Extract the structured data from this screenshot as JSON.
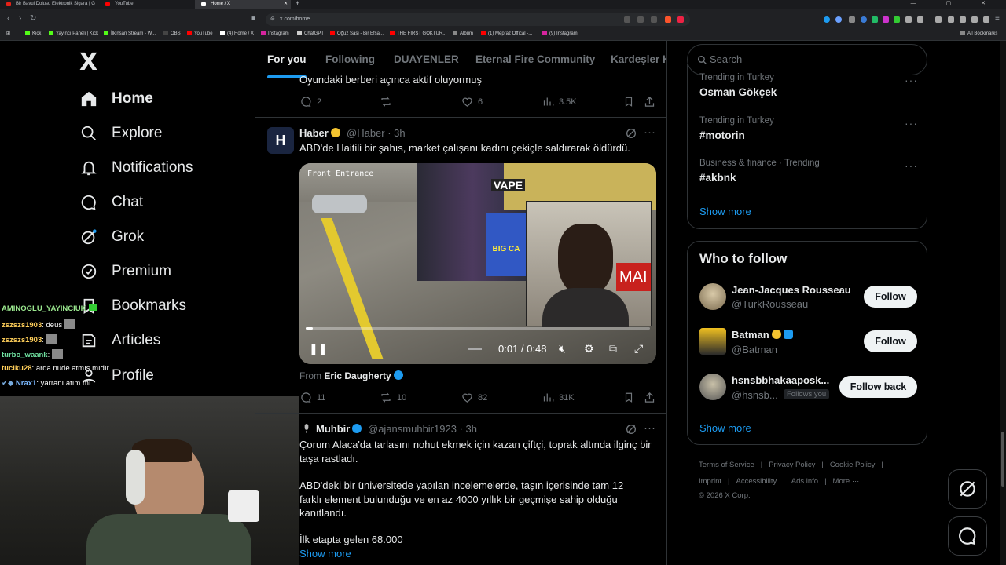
{
  "browser": {
    "tabs": [
      {
        "title": "Bir Bavul Dolusu Elektronik Sigara | G",
        "color": "#e62117"
      },
      {
        "title": "YouTube",
        "color": "#ff0000"
      },
      {
        "title": "Home / X",
        "color": "#ffffff"
      }
    ],
    "url": "x.com/home",
    "bookmarks": [
      {
        "label": "Kick",
        "color": "#53fc18"
      },
      {
        "label": "Yayıncı Paneli | Kick",
        "color": "#53fc18"
      },
      {
        "label": "İlkinsan Stream - W...",
        "color": "#53fc18"
      },
      {
        "label": "OBS",
        "color": "#444"
      },
      {
        "label": "YouTube",
        "color": "#ff0000"
      },
      {
        "label": "(4) Home / X",
        "color": "#ffffff"
      },
      {
        "label": "Instagram",
        "color": "#d6249f"
      },
      {
        "label": "ChatGPT",
        "color": "#cccccc"
      },
      {
        "label": "Oğuz Sasi - Bir Efsa...",
        "color": "#ff0000"
      },
      {
        "label": "THE FIRST GOKTUR...",
        "color": "#ff0000"
      },
      {
        "label": "Albüm",
        "color": "#888"
      },
      {
        "label": "(1) Mepraz Offical -...",
        "color": "#ff0000"
      },
      {
        "label": "(9) Instagram",
        "color": "#d6249f"
      }
    ],
    "all_bookmarks": "All Bookmarks"
  },
  "sidebar": {
    "logo": "X",
    "items": [
      {
        "label": "Home",
        "icon": "home-icon"
      },
      {
        "label": "Explore",
        "icon": "search-icon"
      },
      {
        "label": "Notifications",
        "icon": "bell-icon"
      },
      {
        "label": "Chat",
        "icon": "chat-icon"
      },
      {
        "label": "Grok",
        "icon": "grok-icon"
      },
      {
        "label": "Premium",
        "icon": "premium-icon"
      },
      {
        "label": "Bookmarks",
        "icon": "bookmark-icon"
      },
      {
        "label": "Articles",
        "icon": "article-icon"
      },
      {
        "label": "Profile",
        "icon": "profile-icon"
      }
    ]
  },
  "stream_chat": [
    {
      "user": "AMINOGLU_YAYINCIUK",
      "msg": ""
    },
    {
      "user": "zszszs1903",
      "msg": "deus"
    },
    {
      "user": "zszszs1903",
      "msg": ""
    },
    {
      "user": "turbo_waank",
      "msg": ""
    },
    {
      "user": "tuciku28",
      "msg": "arda nude atmış mıdır"
    },
    {
      "user": "Nrax1",
      "msg": "yarranı atım mı"
    }
  ],
  "feed": {
    "tabs": [
      "For you",
      "Following",
      "DUAYENLER",
      "Eternal Fire Community",
      "Kardeşler Kı"
    ],
    "prev_post": {
      "text": "Oyundaki berberi açınca aktif oluyormuş",
      "replies": "2",
      "reposts": "",
      "likes": "6",
      "views": "3.5K"
    },
    "post1": {
      "avatar_letter": "H",
      "name": "Haber",
      "handle": "@Haber · 3h",
      "text": "ABD'de Haitili bir şahıs, market çalışanı kadını çekiçle saldırarak öldürdü.",
      "video_sign": "Front Entrance",
      "video_store": "VAPE",
      "video_promo": "BIG CA",
      "video_badge": "MAI",
      "video_time": "0:01 / 0:48",
      "video_progress": 0.02,
      "from_label": "From",
      "from_name": "Eric Daugherty",
      "replies": "11",
      "reposts": "10",
      "likes": "82",
      "views": "31K"
    },
    "post2": {
      "name": "Muhbir",
      "handle": "@ajansmuhbir1923 · 3h",
      "p1": "Çorum Alaca'da tarlasını nohut ekmek için kazan çiftçi, toprak altında ilginç bir taşa rastladı.",
      "p2": "ABD'deki bir üniversitede yapılan incelemelerde, taşın içerisinde tam 12 farklı element bulunduğu ve en az 4000 yıllık bir geçmişe sahip olduğu kanıtlandı.",
      "p3": "İlk etapta gelen 68.000",
      "show_more": "Show more"
    }
  },
  "right": {
    "search_placeholder": "Search",
    "trends": [
      {
        "meta": "Trending in Turkey",
        "name": "Osman Gökçek"
      },
      {
        "meta": "Trending in Turkey",
        "name": "#motorin"
      },
      {
        "meta": "Business & finance · Trending",
        "name": "#akbnk"
      }
    ],
    "trends_show_more": "Show more",
    "who_to_follow": "Who to follow",
    "follow": [
      {
        "name": "Jean-Jacques Rousseau",
        "handle": "@TurkRousseau",
        "button": "Follow",
        "badge": ""
      },
      {
        "name": "Batman",
        "handle": "@Batman",
        "button": "Follow",
        "badge": ""
      },
      {
        "name": "hsnsbbhakaaposk...",
        "handle": "@hsnsb...",
        "button": "Follow back",
        "badge": "Follows you"
      }
    ],
    "follow_show_more": "Show more",
    "footer_row1": [
      "Terms of Service",
      "Privacy Policy",
      "Cookie Policy"
    ],
    "footer_row2": [
      "Imprint",
      "Accessibility",
      "Ads info",
      "More ···"
    ],
    "copyright": "© 2026 X Corp."
  },
  "colors": {
    "accent": "#1d9bf0",
    "gold": "#f4c430"
  }
}
